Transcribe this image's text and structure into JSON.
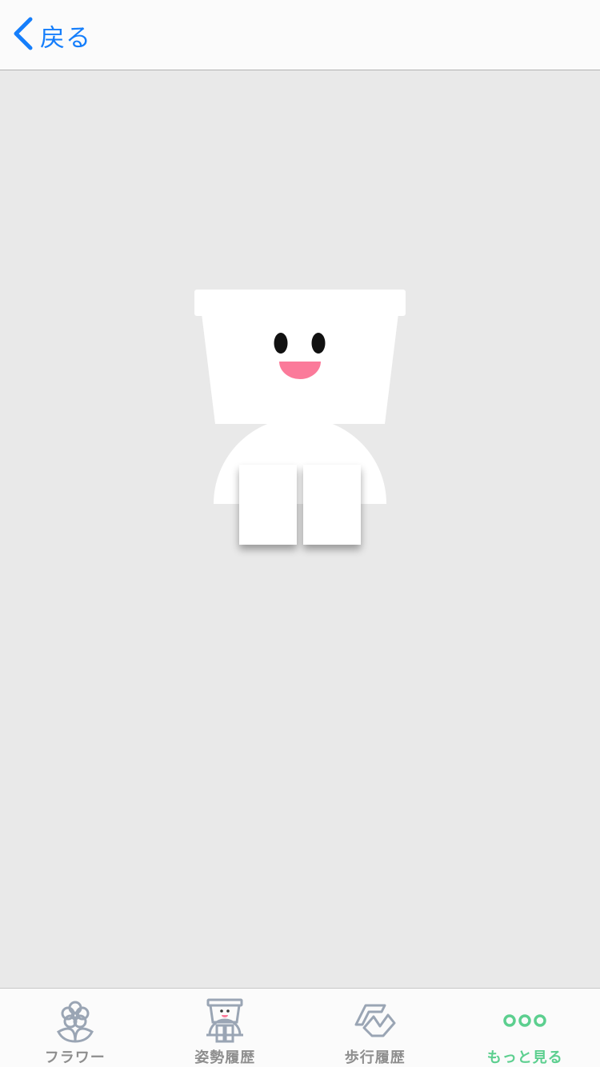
{
  "nav": {
    "back_label": "戻る"
  },
  "tabs": [
    {
      "label": "フラワー",
      "icon": "flower-icon",
      "active": false
    },
    {
      "label": "姿勢履歴",
      "icon": "posture-icon",
      "active": false
    },
    {
      "label": "歩行履歴",
      "icon": "walking-icon",
      "active": false
    },
    {
      "label": "もっと見る",
      "icon": "more-icon",
      "active": true
    }
  ],
  "colors": {
    "accent": "#157efb",
    "active_tab": "#5ccf8f",
    "inactive_tab": "#8e8e8e",
    "icon_inactive": "#9aa5b4",
    "mouth": "#fb7a9a",
    "background": "#e9e9e9"
  }
}
